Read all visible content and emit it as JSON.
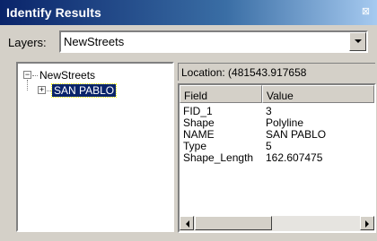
{
  "window": {
    "title": "Identify Results",
    "close_symbol": "⊠"
  },
  "layers": {
    "label": "Layers:",
    "selected_value": "NewStreets"
  },
  "tree": {
    "root": {
      "label": "NewStreets",
      "expander": "−",
      "expanded": true
    },
    "child": {
      "label": "SAN PABLO",
      "expander": "+",
      "expanded": false,
      "selected": true
    }
  },
  "location": {
    "text": "Location: (481543.917658"
  },
  "attributes": {
    "columns": [
      "Field",
      "Value"
    ],
    "rows": [
      {
        "field": "FID_1",
        "value": "3"
      },
      {
        "field": "Shape",
        "value": "Polyline"
      },
      {
        "field": "NAME",
        "value": "SAN PABLO"
      },
      {
        "field": "Type",
        "value": "5"
      },
      {
        "field": "Shape_Length",
        "value": "162.607475"
      }
    ]
  },
  "icons": {
    "dropdown": "chevron-down-icon",
    "scroll_left": "arrow-left-icon",
    "scroll_right": "arrow-right-icon",
    "close": "close-icon"
  },
  "colors": {
    "title_bar_start": "#0a246a",
    "title_bar_end": "#a6caf0",
    "selection": "#0a246a",
    "face": "#d4d0c8"
  }
}
